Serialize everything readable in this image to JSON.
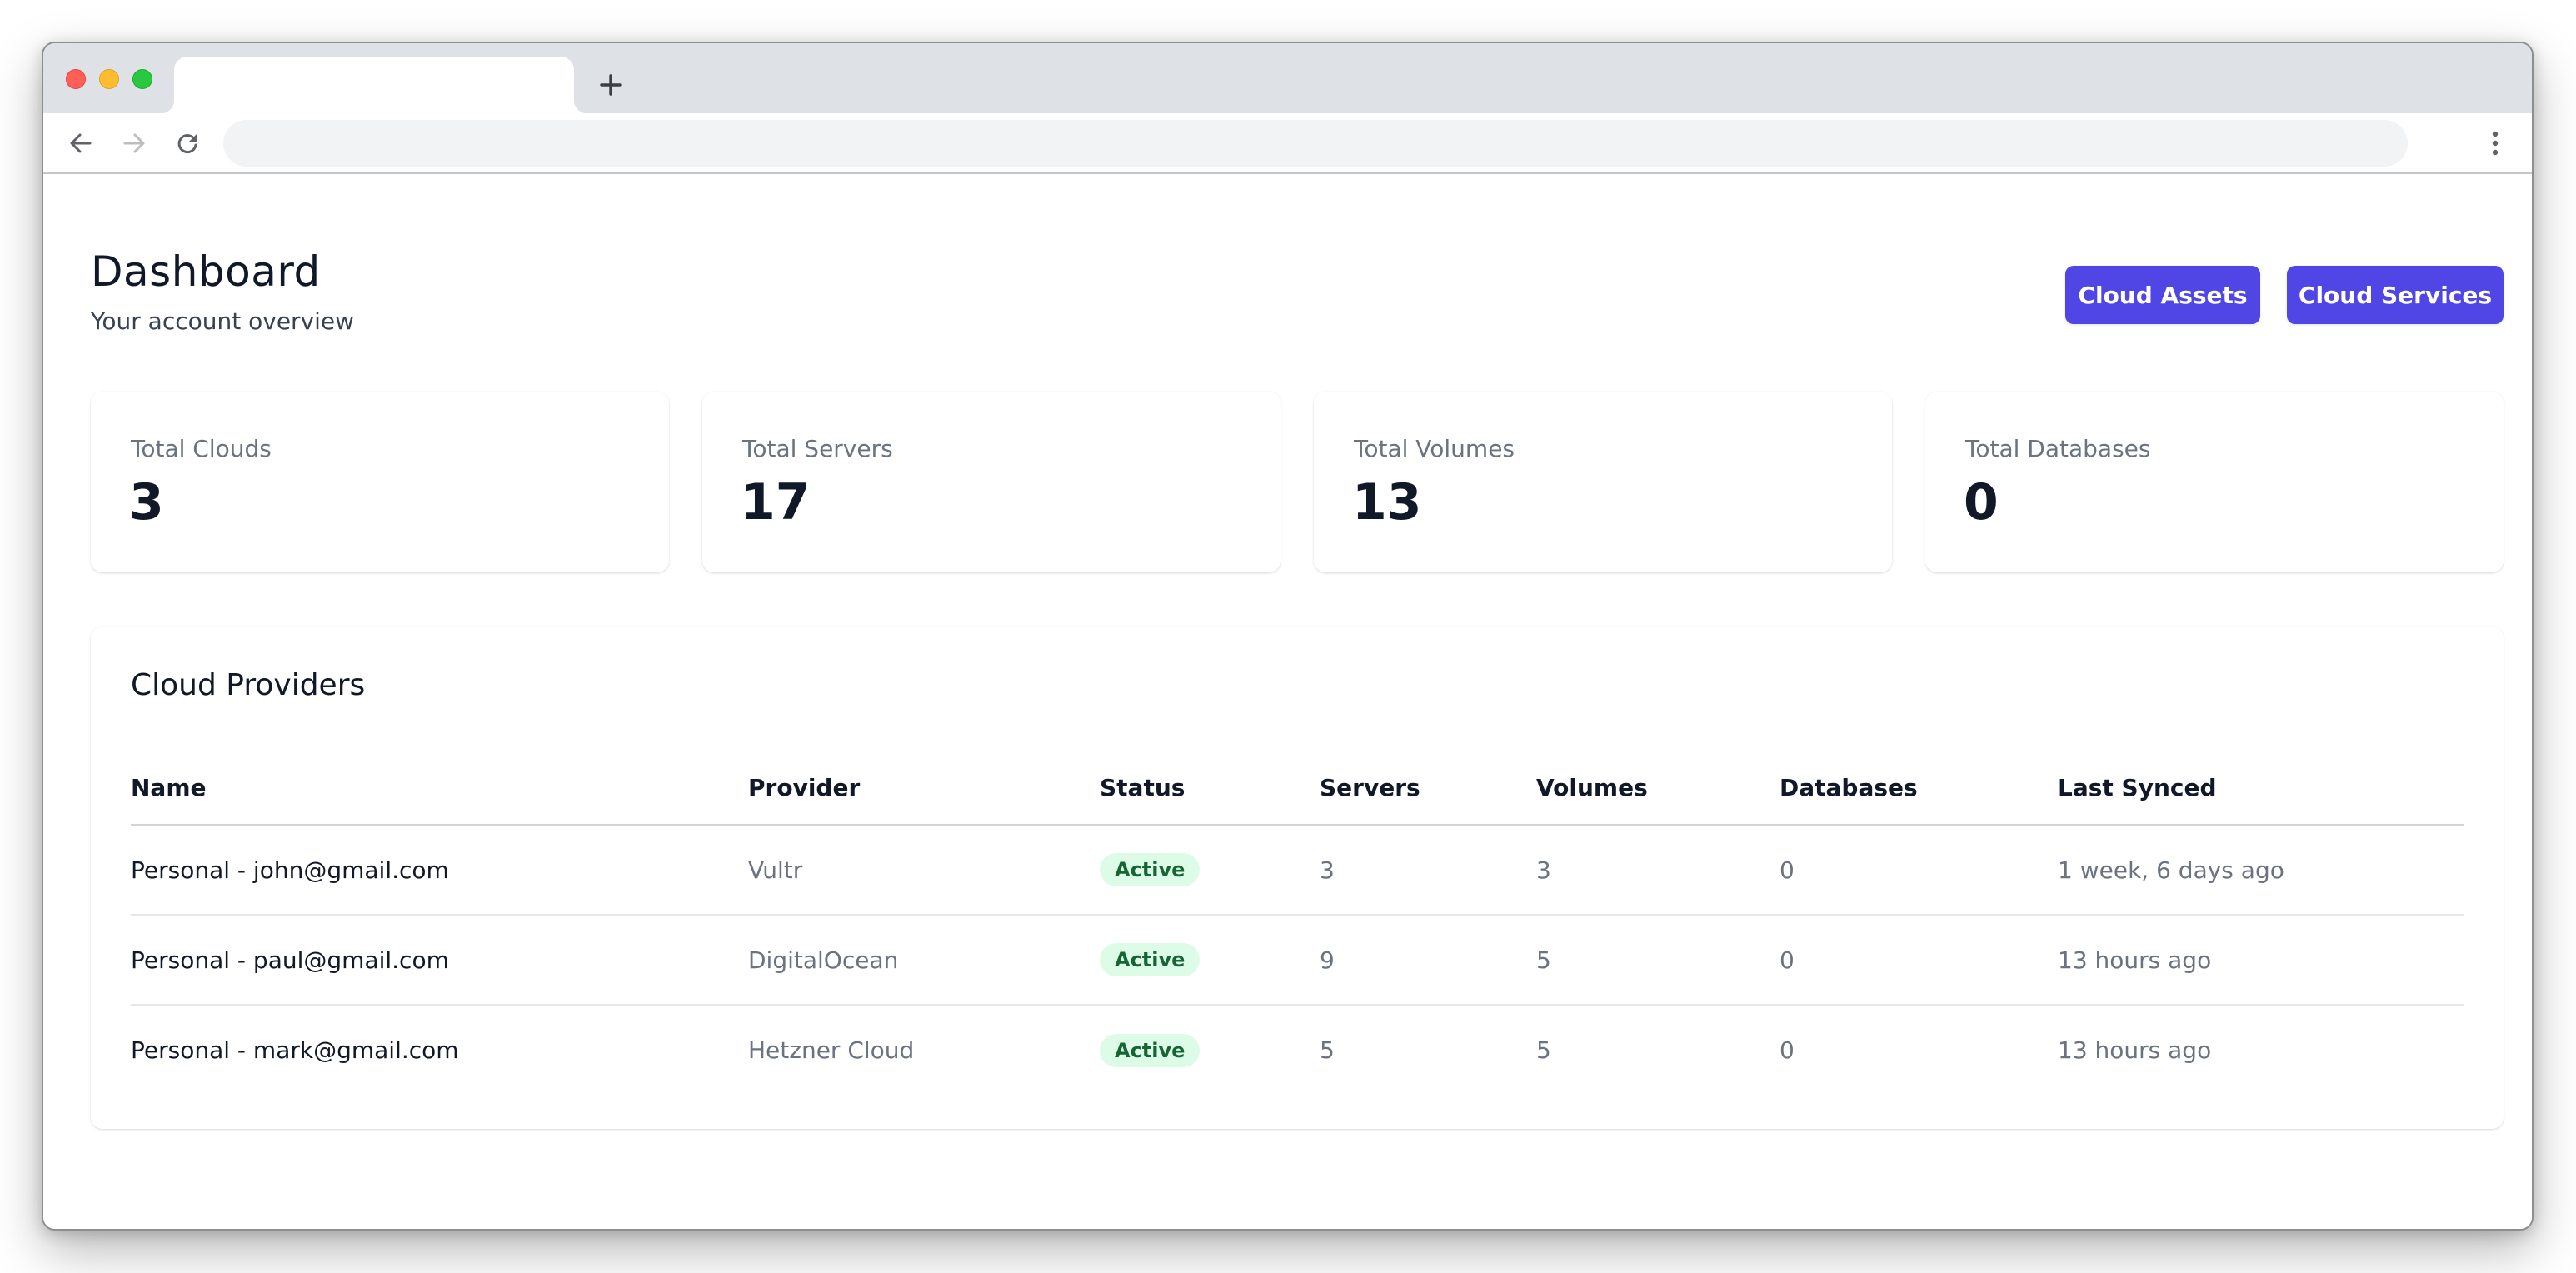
{
  "browser": {
    "tab_title": "",
    "url": "",
    "icons": {
      "new_tab": "plus-icon",
      "back": "arrow-left-icon",
      "forward": "arrow-right-icon",
      "reload": "reload-icon",
      "menu": "kebab-menu-icon"
    },
    "traffic_light_colors": {
      "close": "#ff5f57",
      "minimize": "#febc2e",
      "maximize": "#28c840"
    }
  },
  "header": {
    "title": "Dashboard",
    "subtitle": "Your account overview",
    "buttons": {
      "cloud_assets": "Cloud Assets",
      "cloud_services": "Cloud Services"
    },
    "accent_color": "#4f46e5"
  },
  "stats": [
    {
      "label": "Total Clouds",
      "value": "3"
    },
    {
      "label": "Total Servers",
      "value": "17"
    },
    {
      "label": "Total Volumes",
      "value": "13"
    },
    {
      "label": "Total Databases",
      "value": "0"
    }
  ],
  "providers": {
    "title": "Cloud Providers",
    "columns": [
      "Name",
      "Provider",
      "Status",
      "Servers",
      "Volumes",
      "Databases",
      "Last Synced"
    ],
    "rows": [
      {
        "name": "Personal - john@gmail.com",
        "provider": "Vultr",
        "status": "Active",
        "servers": "3",
        "volumes": "3",
        "databases": "0",
        "last_synced": "1 week, 6 days ago"
      },
      {
        "name": "Personal - paul@gmail.com",
        "provider": "DigitalOcean",
        "status": "Active",
        "servers": "9",
        "volumes": "5",
        "databases": "0",
        "last_synced": "13 hours ago"
      },
      {
        "name": "Personal - mark@gmail.com",
        "provider": "Hetzner Cloud",
        "status": "Active",
        "servers": "5",
        "volumes": "5",
        "databases": "0",
        "last_synced": "13 hours ago"
      }
    ],
    "status_colors": {
      "active_bg": "#dcfce7",
      "active_text": "#166534"
    }
  }
}
